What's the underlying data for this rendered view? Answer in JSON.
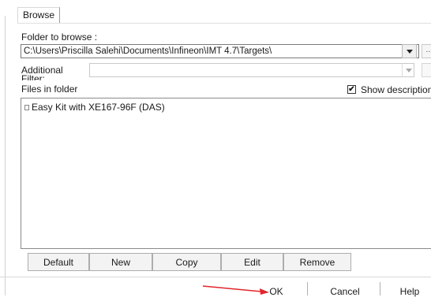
{
  "tab": {
    "label": "Browse"
  },
  "folder": {
    "label": "Folder to browse :",
    "path": "C:\\Users\\Priscilla Salehi\\Documents\\Infineon\\IMT 4.7\\Targets\\",
    "ellipsis": "..."
  },
  "filter": {
    "label_line1": "Additional",
    "label_line2": "Filter:"
  },
  "files": {
    "label": "Files in folder",
    "show_descriptions_label": "Show descriptions",
    "show_descriptions_checked": "✔",
    "items": [
      "Easy Kit with XE167-96F (DAS)"
    ]
  },
  "buttons": {
    "default": "Default",
    "new": "New",
    "copy": "Copy",
    "edit": "Edit",
    "remove": "Remove"
  },
  "footer": {
    "ok": "OK",
    "cancel": "Cancel",
    "help": "Help"
  },
  "colors": {
    "annotation_arrow": "#e0262c"
  }
}
